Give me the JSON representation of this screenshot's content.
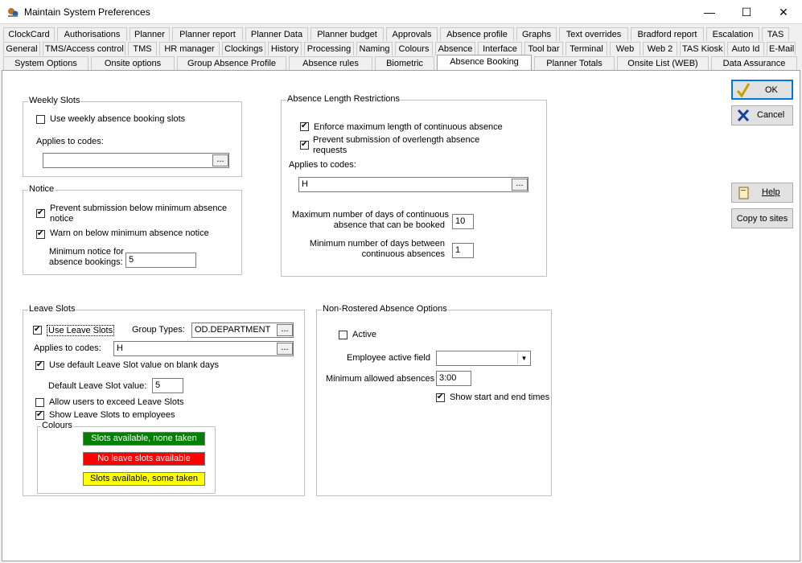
{
  "window": {
    "title": "Maintain System Preferences",
    "minimize": "—",
    "maximize": "☐",
    "close": "✕"
  },
  "tabs": {
    "row1": [
      "ClockCard",
      "Authorisations",
      "Planner",
      "Planner report",
      "Planner Data",
      "Planner budget",
      "Approvals",
      "Absence profile",
      "Graphs",
      "Text overrides",
      "Bradford report",
      "Escalation",
      "TAS"
    ],
    "row2": [
      "General",
      "TMS/Access control",
      "TMS",
      "HR manager",
      "Clockings",
      "History",
      "Processing",
      "Naming",
      "Colours",
      "Absence",
      "Interface",
      "Tool bar",
      "Terminal",
      "Web",
      "Web 2",
      "TAS Kiosk",
      "Auto Id",
      "E-Mail"
    ],
    "row3": [
      "System Options",
      "Onsite options",
      "Group Absence Profile",
      "Absence rules",
      "Biometric",
      "Absence Booking",
      "Planner Totals",
      "Onsite List (WEB)",
      "Data Assurance"
    ],
    "active": "Absence Booking"
  },
  "buttons": {
    "ok": "OK",
    "cancel": "Cancel",
    "help": "Help",
    "copy_to_sites": "Copy to sites",
    "ellipsis": "..."
  },
  "weekly_slots": {
    "legend": "Weekly Slots",
    "use_label": "Use weekly absence booking slots",
    "use_checked": false,
    "applies_label": "Applies to codes:",
    "applies_value": ""
  },
  "notice": {
    "legend": "Notice",
    "prevent_label_1": "Prevent submission below minimum absence",
    "prevent_label_2": "notice",
    "prevent_checked": true,
    "warn_label": "Warn on below minimum absence notice",
    "warn_checked": true,
    "min_label_1": "Minimum notice for",
    "min_label_2": "absence bookings:",
    "min_value": "5"
  },
  "absence_length": {
    "legend": "Absence Length Restrictions",
    "enforce_label": "Enforce maximum length of continuous absence",
    "enforce_checked": true,
    "prevent_label_1": "Prevent submission of overlength absence",
    "prevent_label_2": "requests",
    "prevent_checked": true,
    "applies_label": "Applies to codes:",
    "applies_value": "H",
    "max_label_1": "Maximum number of days of continuous",
    "max_label_2": "absence that can be booked",
    "max_value": "10",
    "min_label_1": "Minimum number of days between",
    "min_label_2": "continuous absences",
    "min_value": "1"
  },
  "leave_slots": {
    "legend": "Leave Slots",
    "use_label": "Use Leave Slots",
    "use_checked": true,
    "group_types_label": "Group Types:",
    "group_types_value": "OD.DEPARTMENT",
    "applies_label": "Applies to codes:",
    "applies_value": "H",
    "use_default_label": "Use default Leave Slot value on blank days",
    "use_default_checked": true,
    "default_value_label": "Default Leave Slot value:",
    "default_value": "5",
    "allow_exceed_label": "Allow users to exceed Leave Slots",
    "allow_exceed_checked": false,
    "show_label": "Show Leave Slots to employees",
    "show_checked": true,
    "colours_legend": "Colours",
    "colours": [
      {
        "label": "Slots available, none taken",
        "bg": "#008000",
        "fg": "#ffffff"
      },
      {
        "label": "No leave slots available",
        "bg": "#ff0000",
        "fg": "#ffffff"
      },
      {
        "label": "Slots available, some taken",
        "bg": "#ffff00",
        "fg": "#000000"
      }
    ]
  },
  "non_rostered": {
    "legend": "Non-Rostered Absence Options",
    "active_label": "Active",
    "active_checked": false,
    "employee_field_label": "Employee active field",
    "employee_field_value": "",
    "min_allowed_label": "Minimum allowed absences",
    "min_allowed_value": "3:00",
    "show_times_label": "Show start and end times",
    "show_times_checked": true
  }
}
